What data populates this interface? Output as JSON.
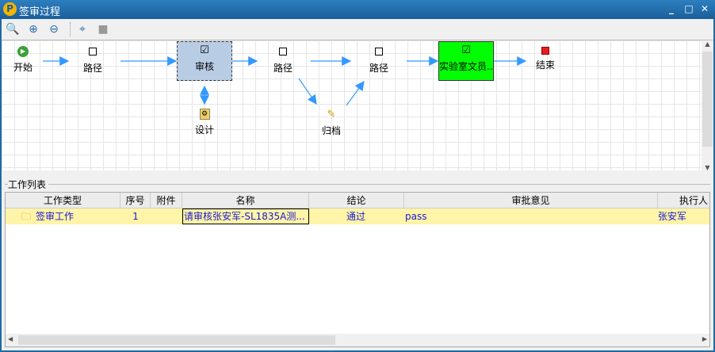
{
  "window": {
    "title": "签审过程",
    "logo": "P"
  },
  "toolbar": {
    "icons": [
      "zoom-fit-icon",
      "zoom-in-icon",
      "zoom-out-icon",
      "fit-page-icon",
      "disabled-icon"
    ]
  },
  "workflow": {
    "nodes": [
      {
        "label": "开始",
        "type": "start"
      },
      {
        "label": "路径",
        "type": "route"
      },
      {
        "label": "审核",
        "type": "task",
        "selected": true
      },
      {
        "label": "设计",
        "type": "task"
      },
      {
        "label": "路径",
        "type": "route"
      },
      {
        "label": "归档",
        "type": "archive"
      },
      {
        "label": "路径",
        "type": "route"
      },
      {
        "label": "实验室文员...",
        "type": "task",
        "active": true
      },
      {
        "label": "结束",
        "type": "end"
      }
    ],
    "colors": {
      "active": "#00ff00",
      "selected": "#b8cce4",
      "arrow": "#3399ff"
    }
  },
  "worklist": {
    "title": "工作列表",
    "columns": [
      "工作类型",
      "序号",
      "附件",
      "名称",
      "结论",
      "审批意见",
      "执行人"
    ],
    "rows": [
      {
        "type": "签审工作",
        "index": "1",
        "attachment": "",
        "name": "请审核张安军-SL1835A测...",
        "conclusion": "通过",
        "opinion": "pass",
        "executor": "张安军"
      }
    ]
  }
}
